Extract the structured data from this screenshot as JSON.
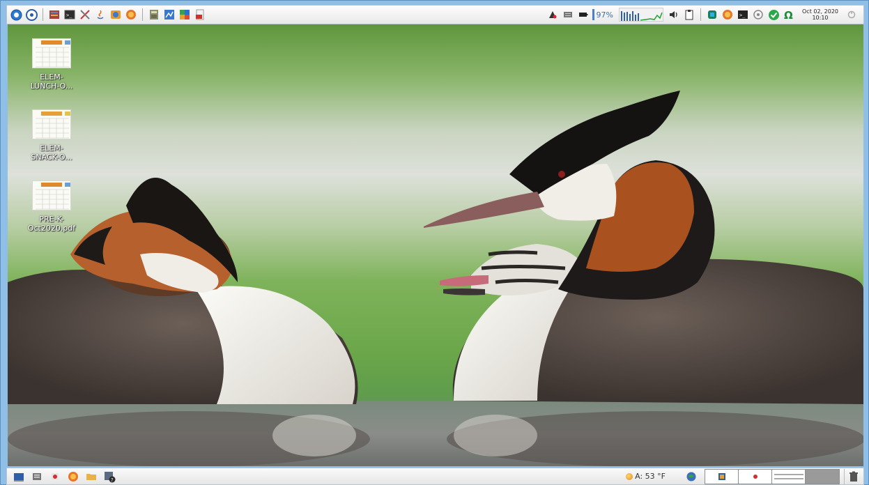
{
  "top_panel": {
    "left_icons": [
      "start-menu-icon",
      "compass-icon",
      "archive-icon",
      "terminal-icon",
      "scissors-icon",
      "java-icon",
      "photo-viewer-icon",
      "browser-icon",
      "calculator-icon",
      "image-editor-icon",
      "office-suite-icon",
      "pdf-viewer-icon"
    ],
    "battery_percent": "97%",
    "clock_date": "Oct 02, 2020",
    "clock_time": "10:10"
  },
  "desktop": {
    "icons": [
      {
        "label": "ELEM-\nLUNCH-O...",
        "thumb_header_color": "#e08a2a"
      },
      {
        "label": "ELEM-\nSNACK-O...",
        "thumb_header_color": "#e6a03a"
      },
      {
        "label": "PRE-K-\nOct2020.pdf",
        "thumb_header_color": "#dd8a2c"
      }
    ]
  },
  "bottom_panel": {
    "left_icons": [
      "show-desktop-icon",
      "file-manager-icon",
      "red-app-icon",
      "firefox-icon",
      "folder-icon",
      "settings-help-icon"
    ],
    "weather": "A: 53 °F"
  },
  "colors": {
    "frame": "#8fbfe6",
    "panel": "#f0f0f0",
    "accent": "#4a80c5"
  }
}
